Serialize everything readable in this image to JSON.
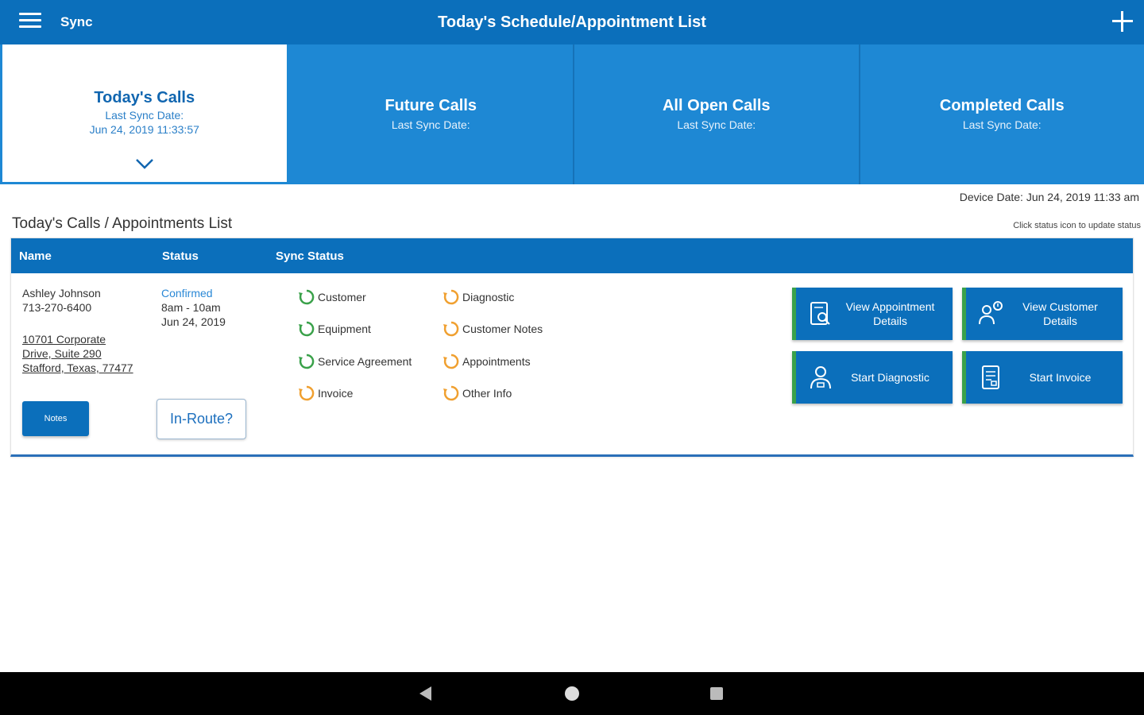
{
  "appbar": {
    "sync_label": "Sync",
    "title": "Today's Schedule/Appointment List"
  },
  "tabs": [
    {
      "label": "Today's Calls",
      "sub": "Last Sync Date:",
      "date": "Jun 24, 2019 11:33:57"
    },
    {
      "label": "Future Calls",
      "sub": "Last Sync Date:"
    },
    {
      "label": "All Open Calls",
      "sub": "Last Sync Date:"
    },
    {
      "label": "Completed Calls",
      "sub": "Last Sync Date:"
    }
  ],
  "device_date": "Device Date: Jun 24, 2019 11:33 am",
  "list_title": "Today's Calls / Appointments List",
  "hint": "Click status icon to update status",
  "table": {
    "headers": {
      "name": "Name",
      "status": "Status",
      "sync": "Sync Status"
    },
    "row": {
      "customer_name": "Ashley Johnson",
      "phone": "713-270-6400",
      "address": "10701 Corporate Drive, Suite 290 Stafford, Texas, 77477",
      "notes_label": "Notes",
      "status": "Confirmed",
      "time": "8am - 10am",
      "date": "Jun 24, 2019",
      "inroute_label": "In-Route?",
      "sync_items": [
        {
          "label": "Customer",
          "state": "synced"
        },
        {
          "label": "Equipment",
          "state": "synced"
        },
        {
          "label": "Service Agreement",
          "state": "synced"
        },
        {
          "label": "Invoice",
          "state": "pending"
        },
        {
          "label": "Diagnostic",
          "state": "pending"
        },
        {
          "label": "Customer Notes",
          "state": "pending"
        },
        {
          "label": "Appointments",
          "state": "pending"
        },
        {
          "label": "Other Info",
          "state": "pending"
        }
      ],
      "actions": [
        {
          "label": "View Appointment Details",
          "icon": "appointment-details-icon"
        },
        {
          "label": "View Customer Details",
          "icon": "customer-details-icon"
        },
        {
          "label": "Start Diagnostic",
          "icon": "technician-icon"
        },
        {
          "label": "Start Invoice",
          "icon": "invoice-icon"
        }
      ]
    }
  },
  "colors": {
    "primary": "#0b6fbb",
    "tab": "#1e88d4",
    "synced": "#3aa14a",
    "pending": "#f0a030",
    "accent_border": "#3aa14a"
  }
}
